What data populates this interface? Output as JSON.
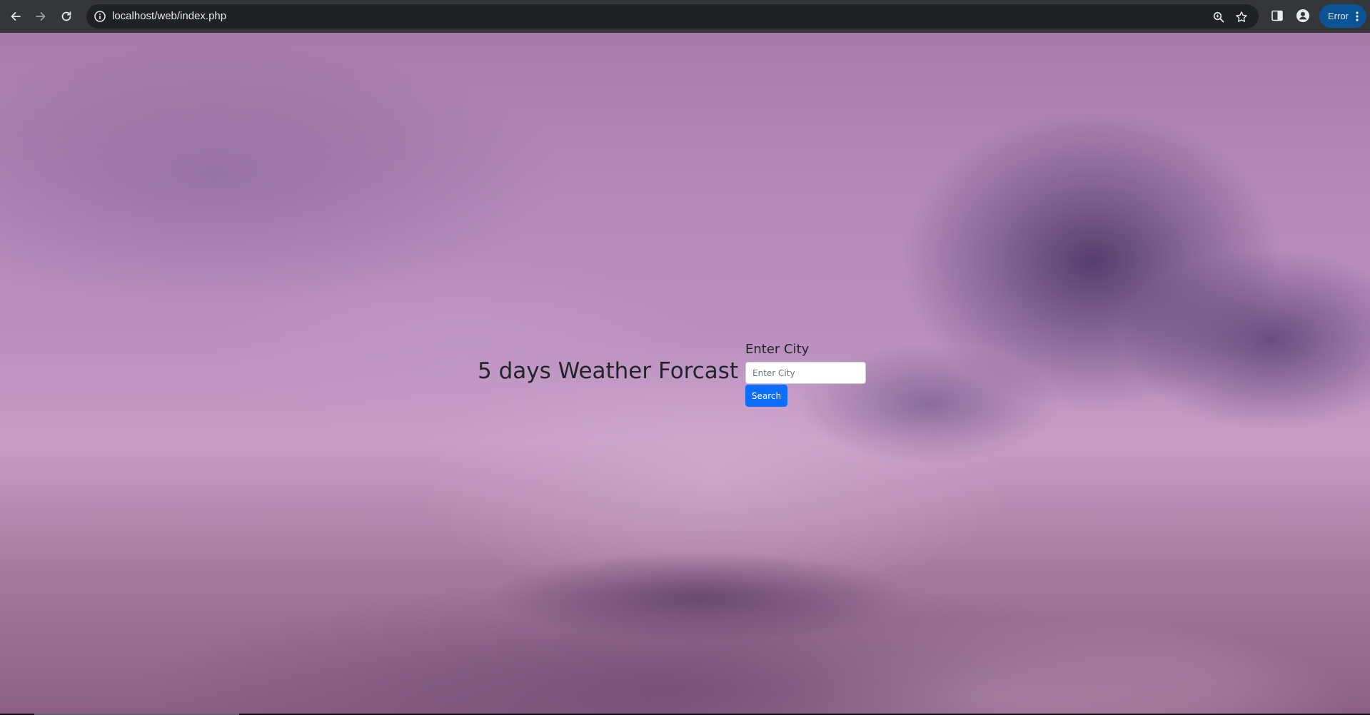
{
  "browser": {
    "url": "localhost/web/index.php",
    "profile_status": "Error",
    "icons": {
      "back": "arrow-left-icon",
      "forward": "arrow-right-icon",
      "reload": "reload-icon",
      "site_info": "info-icon",
      "zoom": "magnifier-icon",
      "bookmark": "star-icon",
      "side_panel": "side-panel-icon",
      "profile": "person-icon",
      "menu": "kebab-menu-icon"
    },
    "colors": {
      "frame": "#35363a",
      "omnibox": "#202124",
      "error_pill": "#0b5394"
    }
  },
  "page": {
    "heading": "5 days Weather Forcast",
    "form": {
      "label": "Enter City",
      "input_placeholder": "Enter City",
      "input_value": "",
      "search_button": "Search"
    },
    "colors": {
      "text": "#212529",
      "button": "#0d6efd",
      "background_theme": "#b48ab9"
    }
  }
}
